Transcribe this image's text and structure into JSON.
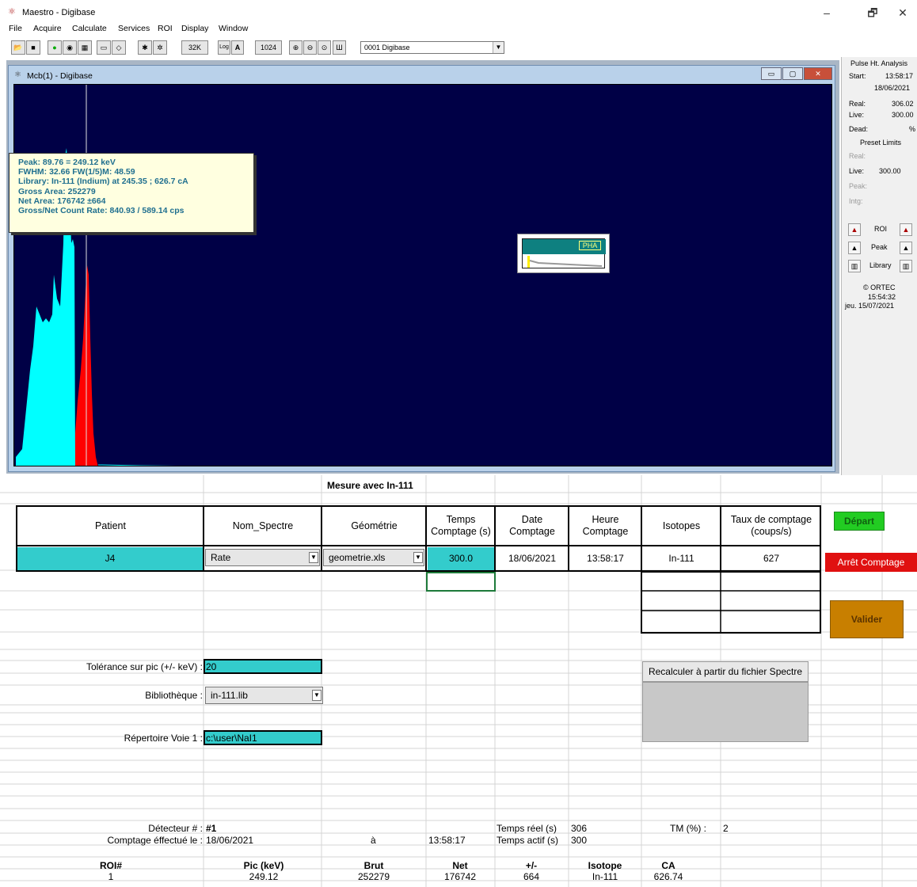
{
  "app": {
    "title": "Maestro - Digibase",
    "window_controls": [
      "–",
      "🗗",
      "✕"
    ]
  },
  "menu": [
    "File",
    "Acquire",
    "Calculate",
    "Services",
    "ROI",
    "Display",
    "Window"
  ],
  "toolbar": {
    "btn_32k": "32K",
    "btn_log": "Log",
    "btn_a": "A",
    "btn_1024": "1024",
    "detector_select": "0001 Digibase"
  },
  "mcb": {
    "title": "Mcb(1) - Digibase",
    "info": [
      "Peak: 89.76 = 249.12 keV",
      "FWHM: 32.66  FW(1/5)M: 48.59",
      "Library: In-111 (Indium) at 245.35 ;  626.7 cA",
      "Gross Area: 252279",
      "Net Area: 176742 ±664",
      "Gross/Net Count Rate: 840.93 / 589.14 cps"
    ],
    "pha_label": "PHA"
  },
  "right_panel": {
    "header": "Pulse Ht. Analysis",
    "start_label": "Start:",
    "start_time": "13:58:17",
    "start_date": "18/06/2021",
    "real_label": "Real:",
    "real_value": "306.02",
    "live_label": "Live:",
    "live_value": "300.00",
    "dead_label": "Dead:",
    "dead_value": "%",
    "preset_header": "Preset Limits",
    "preset_real": "Real:",
    "preset_live_label": "Live:",
    "preset_live_value": "300.00",
    "preset_peak": "Peak:",
    "preset_intg": "Intg:",
    "roi": "ROI",
    "peak": "Peak",
    "library": "Library",
    "brand": "© ORTEC",
    "clock_time": "15:54:32",
    "clock_date": "jeu.  15/07/2021"
  },
  "sheet": {
    "mesure_title": "Mesure avec In-111",
    "headers": {
      "patient": "Patient",
      "nom_spectre": "Nom_Spectre",
      "geometrie": "Géométrie",
      "temps1": "Temps",
      "temps2": "Comptage (s)",
      "date1": "Date",
      "date2": "Comptage",
      "heure1": "Heure",
      "heure2": "Comptage",
      "isotopes": "Isotopes",
      "taux1": "Taux de comptage",
      "taux2": "(coups/s)"
    },
    "row": {
      "patient": "J4",
      "nom_spectre": "Rate",
      "geometrie": "geometrie.xls",
      "temps": "300.0",
      "date": "18/06/2021",
      "heure": "13:58:17",
      "isotope": "In-111",
      "taux": "627"
    },
    "buttons": {
      "depart": "Départ",
      "arret": "Arrêt Comptage",
      "valider": "Valider",
      "recalc": "Recalculer à partir du fichier Spectre"
    },
    "tolerance_label": "Tolérance sur pic (+/- keV) :",
    "tolerance_value": "20",
    "biblio_label": "Bibliothèque :",
    "biblio_value": "in-111.lib",
    "repertoire_label": "Répertoire Voie 1 :",
    "repertoire_value": "c:\\user\\NaI1",
    "detecteur_label": "Détecteur # :",
    "detecteur_value": "#1",
    "comptage_label": "Comptage éffectué le :",
    "comptage_date": "18/06/2021",
    "a_label": "à",
    "comptage_heure": "13:58:17",
    "temps_reel_label": "Temps réel (s)",
    "temps_reel_value": "306",
    "temps_actif_label": "Temps actif (s)",
    "temps_actif_value": "300",
    "tm_label": "TM (%) :",
    "tm_value": "2",
    "results_headers": [
      "ROI#",
      "Pic (keV)",
      "Brut",
      "Net",
      "+/-",
      "Isotope",
      "CA"
    ],
    "results_row": [
      "1",
      "249.12",
      "252279",
      "176742",
      "664",
      "In-111",
      "626.74"
    ]
  },
  "colors": {
    "spectrum_bg": "#000046",
    "spectrum_cyan": "#00ffff",
    "spectrum_red": "#ff0000",
    "turquoise_cell": "#33cccc",
    "depart_green": "#22cc22",
    "arret_red": "#e01010",
    "valider_orange": "#c87f00"
  }
}
